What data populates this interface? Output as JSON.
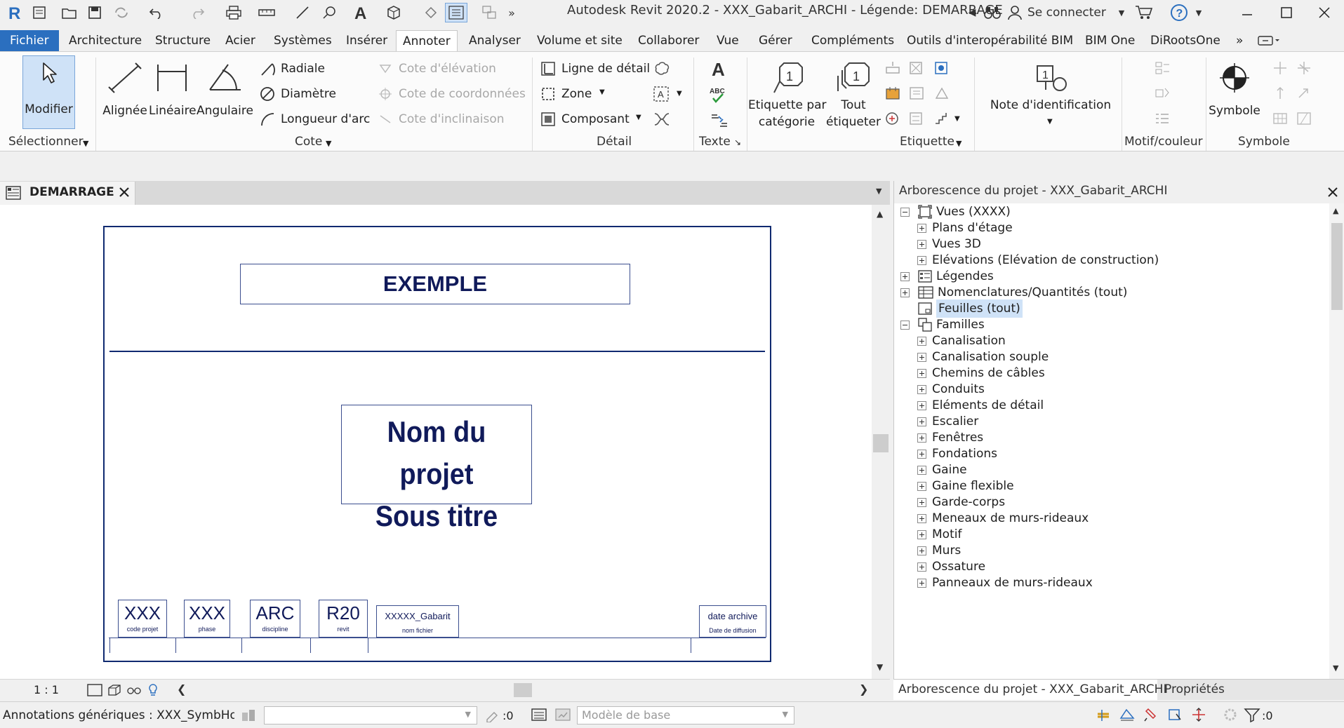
{
  "window": {
    "title": "Autodesk Revit 2020.2 - XXX_Gabarit_ARCHI - Légende: DEMARRAGE",
    "sign_in": "Se connecter",
    "help": "?"
  },
  "menu_tabs": [
    "Fichier",
    "Architecture",
    "Structure",
    "Acier",
    "Systèmes",
    "Insérer",
    "Annoter",
    "Analyser",
    "Volume et site",
    "Collaborer",
    "Vue",
    "Gérer",
    "Compléments",
    "Outils d'interopérabilité BIM",
    "BIM One",
    "DiRootsOne"
  ],
  "ribbon": {
    "select": {
      "button": "Modifier",
      "panel": "Sélectionner"
    },
    "dimension": {
      "aligned": "Alignée",
      "linear": "Linéaire",
      "angular": "Angulaire",
      "radial": "Radiale",
      "diameter": "Diamètre",
      "arc_length": "Longueur  d'arc",
      "spot_elevation": "Cote  d'élévation",
      "spot_coordinate": "Cote  de coordonnées",
      "spot_slope": "Cote  d'inclinaison",
      "panel": "Cote"
    },
    "detail": {
      "detail_line": "Ligne de détail",
      "region": "Zone",
      "component": "Composant",
      "panel": "Détail"
    },
    "text": {
      "panel": "Texte",
      "abc": "ABC"
    },
    "tag": {
      "by_category_1": "Etiquette par",
      "by_category_2": "catégorie",
      "tag_all_1": "Tout",
      "tag_all_2": "étiqueter",
      "panel": "Etiquette"
    },
    "keynote": {
      "label": "Note d'identification"
    },
    "pattern": {
      "panel": "Motif/couleur"
    },
    "symbol": {
      "button": "Symbole",
      "panel": "Symbole"
    }
  },
  "view": {
    "tab_name": "DEMARRAGE",
    "scale": "1 : 1",
    "sheet": {
      "header": "EXEMPLE",
      "project_name": "Nom du projet",
      "subtitle": "Sous titre",
      "title_block": [
        {
          "value": "XXX",
          "label": "code projet"
        },
        {
          "value": "XXX",
          "label": "phase"
        },
        {
          "value": "ARC",
          "label": "discipline"
        },
        {
          "value": "R20",
          "label": "revit"
        },
        {
          "value": "XXXXX_Gabarit",
          "label": "nom fichier"
        },
        {
          "value": "date archive",
          "label": "Date de diffusion"
        }
      ]
    }
  },
  "browser": {
    "title": "Arborescence du projet - XXX_Gabarit_ARCHI",
    "items": [
      {
        "label": "Vues (XXXX)",
        "level": 0,
        "state": "minus",
        "icon": "views-icon"
      },
      {
        "label": "Plans d'étage",
        "level": 1,
        "state": "plus"
      },
      {
        "label": "Vues 3D",
        "level": 1,
        "state": "plus"
      },
      {
        "label": "Elévations (Elévation de construction)",
        "level": 1,
        "state": "plus"
      },
      {
        "label": "Légendes",
        "level": 0,
        "state": "plus",
        "icon": "legend-icon"
      },
      {
        "label": "Nomenclatures/Quantités (tout)",
        "level": 0,
        "state": "plus",
        "icon": "schedule-icon"
      },
      {
        "label": "Feuilles (tout)",
        "level": 0,
        "state": "none",
        "icon": "sheet-icon",
        "selected": true
      },
      {
        "label": "Familles",
        "level": 0,
        "state": "minus",
        "icon": "families-icon"
      },
      {
        "label": "Canalisation",
        "level": 1,
        "state": "plus"
      },
      {
        "label": "Canalisation souple",
        "level": 1,
        "state": "plus"
      },
      {
        "label": "Chemins de câbles",
        "level": 1,
        "state": "plus"
      },
      {
        "label": "Conduits",
        "level": 1,
        "state": "plus"
      },
      {
        "label": "Eléments de détail",
        "level": 1,
        "state": "plus"
      },
      {
        "label": "Escalier",
        "level": 1,
        "state": "plus"
      },
      {
        "label": "Fenêtres",
        "level": 1,
        "state": "plus"
      },
      {
        "label": "Fondations",
        "level": 1,
        "state": "plus"
      },
      {
        "label": "Gaine",
        "level": 1,
        "state": "plus"
      },
      {
        "label": "Gaine flexible",
        "level": 1,
        "state": "plus"
      },
      {
        "label": "Garde-corps",
        "level": 1,
        "state": "plus"
      },
      {
        "label": "Meneaux de murs-rideaux",
        "level": 1,
        "state": "plus"
      },
      {
        "label": "Motif",
        "level": 1,
        "state": "plus"
      },
      {
        "label": "Murs",
        "level": 1,
        "state": "plus"
      },
      {
        "label": "Ossature",
        "level": 1,
        "state": "plus"
      },
      {
        "label": "Panneaux de murs-rideaux",
        "level": 1,
        "state": "plus"
      }
    ],
    "tabs": [
      "Arborescence du projet - XXX_Gabarit_ARCHI",
      "Propriétés"
    ]
  },
  "status": {
    "message": "Annotations génériques : XXX_SymbHom",
    "filter_count": ":0",
    "model": "Modèle de base",
    "select_count": ":0"
  },
  "colors": {
    "accent": "#2b6fbf",
    "sheet_blue": "#102a70",
    "selected": "#cfe2f7"
  }
}
